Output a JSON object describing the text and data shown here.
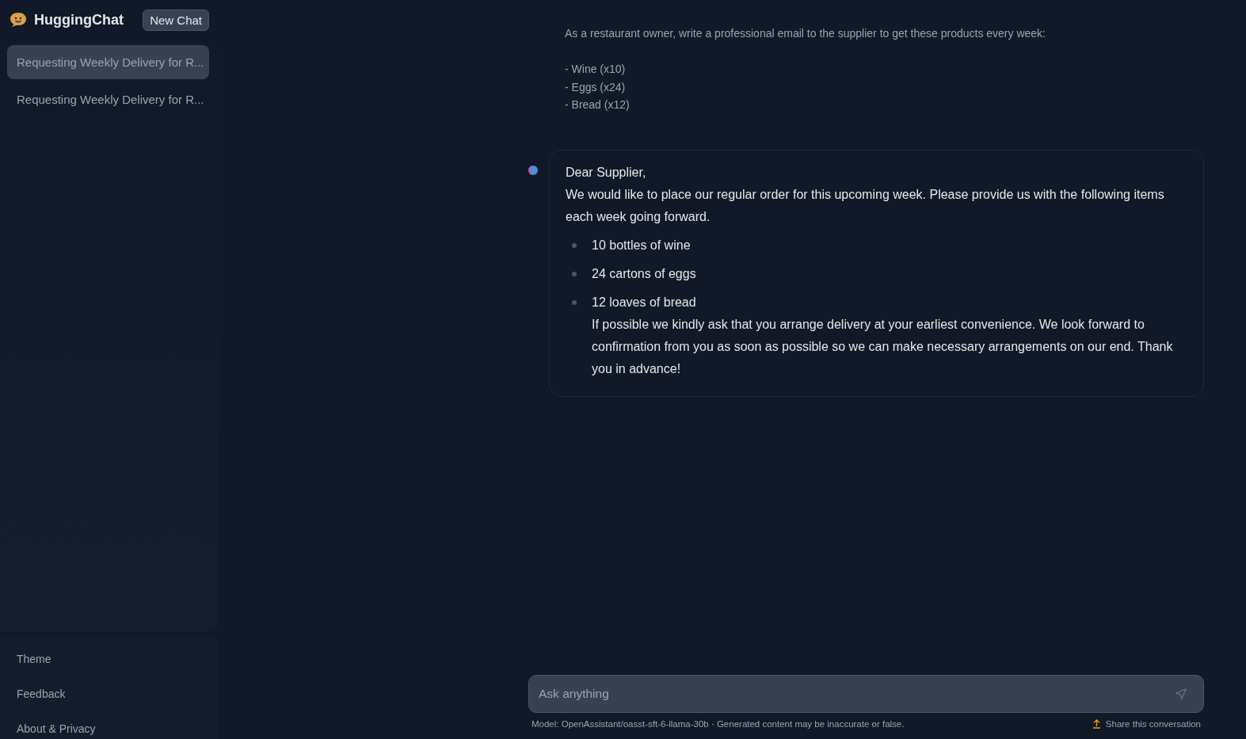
{
  "app": {
    "name": "HuggingChat",
    "new_chat_button": "New Chat"
  },
  "conversations": [
    {
      "title": "Requesting Weekly Delivery for R...",
      "selected": true
    },
    {
      "title": "Requesting Weekly Delivery for R...",
      "selected": false
    }
  ],
  "sidebar_footer": [
    "Theme",
    "Feedback",
    "About & Privacy"
  ],
  "user_message": {
    "lines": [
      "As a restaurant owner, write a professional email to the supplier to get these products every week:",
      "- Wine (x10)",
      "- Eggs (x24)",
      "- Bread (x12)"
    ]
  },
  "assistant_message": {
    "greeting": "Dear Supplier,",
    "paragraph": "We would like to place our regular order for this upcoming week. Please provide us with the following items each week going forward.",
    "bullets": [
      "10 bottles of wine",
      "24 cartons of eggs",
      "12 loaves of bread"
    ],
    "closing": "If possible we kindly ask that you arrange delivery at your earliest convenience. We look forward to confirmation from you as soon as possible so we can make necessary arrangements on our end. Thank you in advance!"
  },
  "input": {
    "placeholder": "Ask anything"
  },
  "footer": {
    "model_note": "Model: OpenAssistant/oasst-sft-6-llama-30b · Generated content may be inaccurate or false.",
    "share_link": "Share this conversation"
  }
}
